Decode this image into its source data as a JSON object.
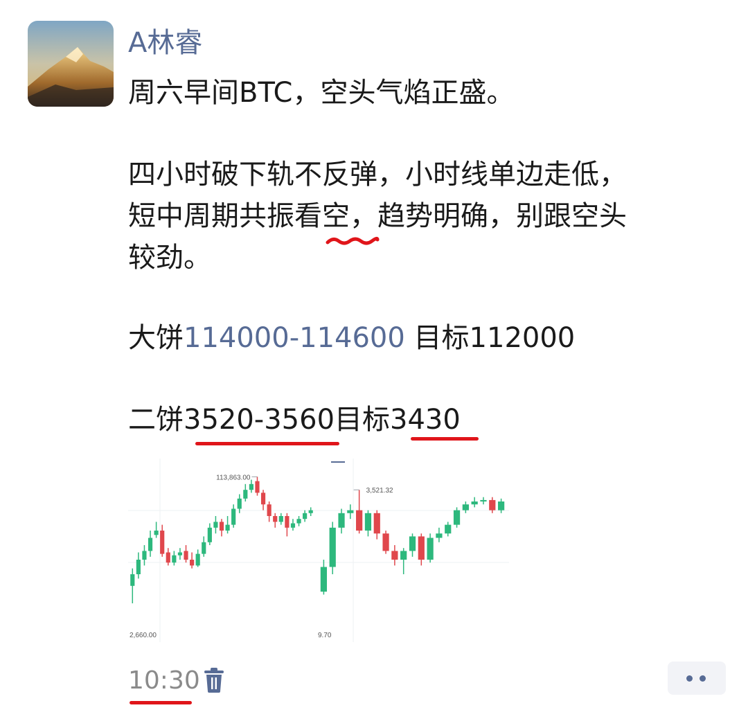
{
  "post": {
    "username": "A林睿",
    "lines": {
      "l1": "周六早间BTC，空头气焰正盛。",
      "l2": "四小时破下轨不反弹，小时线单边走低，",
      "l3a": "短中周期共振看空，趋势明确，别跟空头",
      "l4": "较劲。",
      "l5_prefix": "大饼",
      "l5_link": "114000-114600",
      "l5_suffix": "  目标112000",
      "l6_a": "二饼",
      "l6_b": "3520-3560",
      "l6_c": "目标",
      "l6_d": "3430"
    },
    "time": "10:30"
  },
  "chart_data": [
    {
      "type": "candlestick",
      "title": "",
      "annotations": [
        "113,863.00",
        "2,660.00"
      ],
      "high_label": "113,863.00",
      "low_label": "2,660.00",
      "colors": {
        "up": "#2db87d",
        "down": "#e0474c"
      },
      "candles": [
        {
          "o": 0.22,
          "c": 0.3,
          "h": 0.34,
          "l": 0.1
        },
        {
          "o": 0.3,
          "c": 0.4,
          "h": 0.45,
          "l": 0.27
        },
        {
          "o": 0.4,
          "c": 0.46,
          "h": 0.5,
          "l": 0.36
        },
        {
          "o": 0.46,
          "c": 0.55,
          "h": 0.6,
          "l": 0.42
        },
        {
          "o": 0.57,
          "c": 0.6,
          "h": 0.66,
          "l": 0.55
        },
        {
          "o": 0.6,
          "c": 0.44,
          "h": 0.64,
          "l": 0.42
        },
        {
          "o": 0.45,
          "c": 0.38,
          "h": 0.48,
          "l": 0.36
        },
        {
          "o": 0.38,
          "c": 0.43,
          "h": 0.46,
          "l": 0.36
        },
        {
          "o": 0.43,
          "c": 0.45,
          "h": 0.48,
          "l": 0.4
        },
        {
          "o": 0.46,
          "c": 0.4,
          "h": 0.5,
          "l": 0.38
        },
        {
          "o": 0.4,
          "c": 0.36,
          "h": 0.45,
          "l": 0.34
        },
        {
          "o": 0.36,
          "c": 0.44,
          "h": 0.47,
          "l": 0.35
        },
        {
          "o": 0.44,
          "c": 0.52,
          "h": 0.56,
          "l": 0.42
        },
        {
          "o": 0.52,
          "c": 0.62,
          "h": 0.65,
          "l": 0.5
        },
        {
          "o": 0.62,
          "c": 0.66,
          "h": 0.7,
          "l": 0.58
        },
        {
          "o": 0.66,
          "c": 0.6,
          "h": 0.68,
          "l": 0.56
        },
        {
          "o": 0.6,
          "c": 0.64,
          "h": 0.7,
          "l": 0.58
        },
        {
          "o": 0.64,
          "c": 0.75,
          "h": 0.78,
          "l": 0.62
        },
        {
          "o": 0.75,
          "c": 0.82,
          "h": 0.85,
          "l": 0.72
        },
        {
          "o": 0.82,
          "c": 0.88,
          "h": 0.92,
          "l": 0.8
        },
        {
          "o": 0.88,
          "c": 0.92,
          "h": 0.95,
          "l": 0.86
        },
        {
          "o": 0.94,
          "c": 0.86,
          "h": 0.97,
          "l": 0.84
        },
        {
          "o": 0.86,
          "c": 0.78,
          "h": 0.88,
          "l": 0.74
        },
        {
          "o": 0.78,
          "c": 0.7,
          "h": 0.8,
          "l": 0.66
        },
        {
          "o": 0.7,
          "c": 0.66,
          "h": 0.72,
          "l": 0.62
        },
        {
          "o": 0.66,
          "c": 0.7,
          "h": 0.72,
          "l": 0.64
        },
        {
          "o": 0.7,
          "c": 0.62,
          "h": 0.72,
          "l": 0.56
        },
        {
          "o": 0.62,
          "c": 0.65,
          "h": 0.68,
          "l": 0.6
        },
        {
          "o": 0.65,
          "c": 0.68,
          "h": 0.7,
          "l": 0.63
        },
        {
          "o": 0.68,
          "c": 0.72,
          "h": 0.74,
          "l": 0.66
        },
        {
          "o": 0.72,
          "c": 0.74,
          "h": 0.76,
          "l": 0.7
        }
      ]
    },
    {
      "type": "candlestick",
      "title": "",
      "annotations": [
        "3,521.32",
        "9.70"
      ],
      "high_label": "3,521.32",
      "low_label": "9.70",
      "colors": {
        "up": "#2db87d",
        "down": "#e0474c"
      },
      "candles": [
        {
          "o": 0.18,
          "c": 0.35,
          "h": 0.4,
          "l": 0.16
        },
        {
          "o": 0.35,
          "c": 0.62,
          "h": 0.66,
          "l": 0.3
        },
        {
          "o": 0.62,
          "c": 0.72,
          "h": 0.75,
          "l": 0.58
        },
        {
          "o": 0.72,
          "c": 0.74,
          "h": 0.78,
          "l": 0.68
        },
        {
          "o": 0.74,
          "c": 0.6,
          "h": 0.88,
          "l": 0.58
        },
        {
          "o": 0.6,
          "c": 0.72,
          "h": 0.74,
          "l": 0.56
        },
        {
          "o": 0.72,
          "c": 0.58,
          "h": 0.74,
          "l": 0.54
        },
        {
          "o": 0.58,
          "c": 0.46,
          "h": 0.6,
          "l": 0.44
        },
        {
          "o": 0.46,
          "c": 0.4,
          "h": 0.5,
          "l": 0.36
        },
        {
          "o": 0.4,
          "c": 0.46,
          "h": 0.48,
          "l": 0.3
        },
        {
          "o": 0.46,
          "c": 0.56,
          "h": 0.58,
          "l": 0.42
        },
        {
          "o": 0.56,
          "c": 0.4,
          "h": 0.58,
          "l": 0.36
        },
        {
          "o": 0.4,
          "c": 0.55,
          "h": 0.58,
          "l": 0.38
        },
        {
          "o": 0.55,
          "c": 0.58,
          "h": 0.62,
          "l": 0.52
        },
        {
          "o": 0.58,
          "c": 0.64,
          "h": 0.66,
          "l": 0.56
        },
        {
          "o": 0.64,
          "c": 0.74,
          "h": 0.76,
          "l": 0.62
        },
        {
          "o": 0.74,
          "c": 0.78,
          "h": 0.8,
          "l": 0.72
        },
        {
          "o": 0.78,
          "c": 0.8,
          "h": 0.83,
          "l": 0.76
        },
        {
          "o": 0.8,
          "c": 0.81,
          "h": 0.83,
          "l": 0.78
        },
        {
          "o": 0.81,
          "c": 0.74,
          "h": 0.83,
          "l": 0.72
        },
        {
          "o": 0.74,
          "c": 0.8,
          "h": 0.82,
          "l": 0.72
        }
      ]
    }
  ],
  "icons": {
    "trash": "trash-icon",
    "more": "more-dots-icon"
  },
  "colors": {
    "link": "#576b95",
    "underline": "#e0151a",
    "time": "#8a8a8a"
  }
}
